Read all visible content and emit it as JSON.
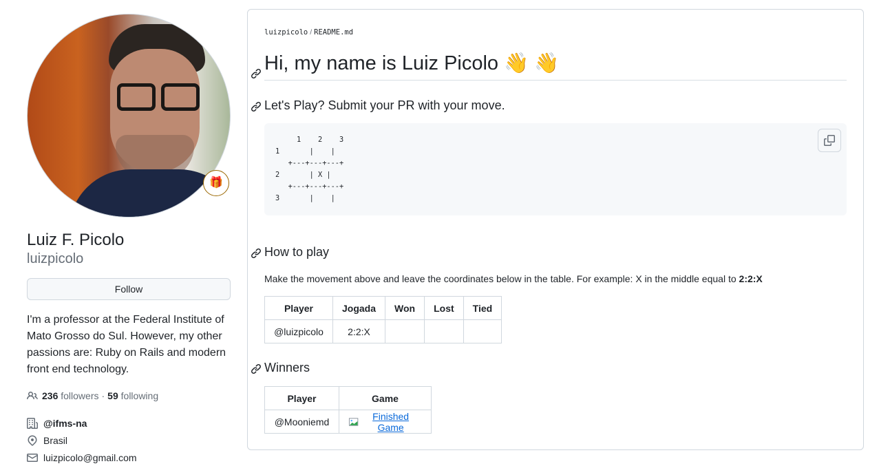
{
  "profile": {
    "full_name": "Luiz F. Picolo",
    "username": "luizpicolo",
    "status_emoji": "🎁",
    "follow_label": "Follow",
    "bio": "I'm a professor at the Federal Institute of Mato Grosso do Sul. However, my other passions are: Ruby on Rails and modern front end technology.",
    "followers_count": "236",
    "followers_label": "followers",
    "separator": "·",
    "following_count": "59",
    "following_label": "following",
    "organization": "@ifms-na",
    "location": "Brasil",
    "email": "luizpicolo@gmail.com"
  },
  "readme": {
    "breadcrumb_user": "luizpicolo",
    "breadcrumb_sep": "/",
    "breadcrumb_file": "README.md",
    "title": "Hi, my name is Luiz Picolo 👋 👋",
    "section_play": "Let's Play? Submit your PR with your move.",
    "board": "     1    2    3\n1       |    |\n   +---+---+---+\n2       | X |\n   +---+---+---+\n3       |    |",
    "section_howto": "How to play",
    "howto_text": "Make the movement above and leave the coordinates below in the table. For example: X in the middle equal to ",
    "howto_example": "2:2:X",
    "moves_table": {
      "headers": [
        "Player",
        "Jogada",
        "Won",
        "Lost",
        "Tied"
      ],
      "rows": [
        [
          "@luizpicolo",
          "2:2:X",
          "",
          "",
          ""
        ]
      ]
    },
    "section_winners": "Winners",
    "winners_table": {
      "headers": [
        "Player",
        "Game"
      ],
      "rows": [
        [
          "@Mooniemd",
          "Finished Game"
        ]
      ]
    }
  },
  "colors": {
    "link": "#0969da",
    "border": "#d0d7de",
    "muted": "#656d76",
    "text": "#1f2328"
  }
}
